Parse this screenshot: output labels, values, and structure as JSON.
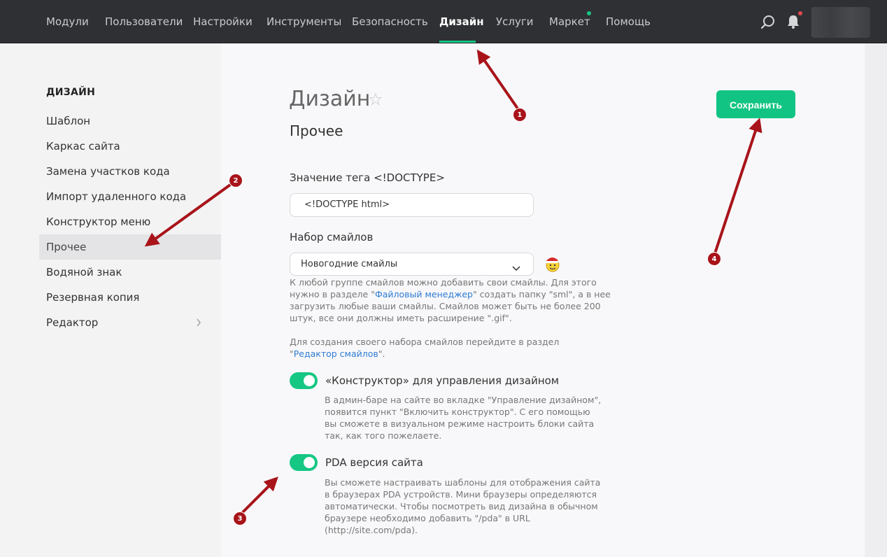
{
  "nav": {
    "items": [
      "Модули",
      "Пользователи",
      "Настройки",
      "Инструменты",
      "Безопасность",
      "Дизайн",
      "Услуги",
      "Маркет",
      "Помощь"
    ],
    "active": "Дизайн"
  },
  "sidebar": {
    "heading": "ДИЗАЙН",
    "items": [
      "Шаблон",
      "Каркас сайта",
      "Замена участков кода",
      "Импорт удаленного кода",
      "Конструктор меню",
      "Прочее",
      "Водяной знак",
      "Резервная копия",
      "Редактор"
    ],
    "active": "Прочее"
  },
  "page": {
    "title": "Дизайн",
    "subtitle": "Прочее",
    "save_label": "Сохранить"
  },
  "doctype": {
    "label": "Значение тега <!DOCTYPE>",
    "value": "<!DOCTYPE html>"
  },
  "smiles": {
    "label": "Набор смайлов",
    "selected": "Новогодние смайлы",
    "help_part1": "К любой группе смайлов можно добавить свои смайлы. Для этого нужно в разделе \"",
    "help_link": "Файловый менеджер",
    "help_part2": "\" создать папку \"sml\", а в нее загрузить любые ваши смайлы. Смайлов может быть не более 200 штук, все они должны иметь расширение \".gif\".",
    "editor_part1": "Для создания своего набора смайлов перейдите в раздел \"",
    "editor_link": "Редактор смайлов",
    "editor_part2": "\"."
  },
  "constructor_toggle": {
    "label": "«Конструктор» для управления дизайном",
    "on": true,
    "help": "В админ-баре на сайте во вкладке \"Управление дизайном\", появится пункт \"Включить конструктор\". С его помощью вы сможете в визуальном режиме настроить блоки сайта так, как того пожелаете."
  },
  "pda_toggle": {
    "label": "PDA версия сайта",
    "on": true,
    "help": "Вы сможете настраивать шаблоны для отображения сайта в браузерах PDA устройств. Мини браузеры определяются автоматически. Чтобы посмотреть вид дизайна в обычном браузере необходимо добавить \"/pda\" в URL (http://site.com/pda)."
  },
  "annotations": [
    "1",
    "2",
    "3",
    "4"
  ],
  "colors": {
    "accent": "#16c784",
    "topbar": "#2f3033",
    "annotation": "#a8141a",
    "link": "#2e7bd3"
  },
  "icons": {
    "search": "search-icon",
    "bell": "bell-icon",
    "star": "star-icon",
    "chevron": "chevron-down-icon",
    "smiley": "santa-smiley-icon"
  }
}
